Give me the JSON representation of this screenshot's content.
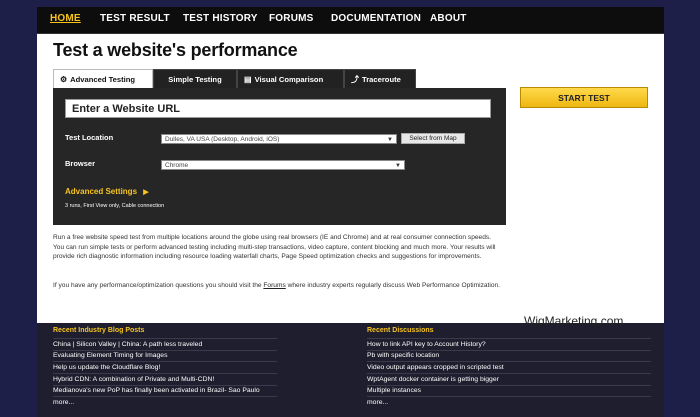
{
  "nav": {
    "items": [
      "HOME",
      "TEST RESULT",
      "TEST HISTORY",
      "FORUMS",
      "DOCUMENTATION",
      "ABOUT"
    ]
  },
  "page": {
    "title": "Test a website's performance"
  },
  "tabs": [
    "Advanced Testing",
    "Simple Testing",
    "Visual Comparison",
    "Traceroute"
  ],
  "form": {
    "url_placeholder": "Enter a Website URL",
    "location_label": "Test Location",
    "location_value": "Dulles, VA USA (Desktop, Android, iOS)",
    "select_from_map": "Select from Map",
    "browser_label": "Browser",
    "browser_value": "Chrome",
    "advanced_settings": "Advanced Settings",
    "advanced_summary": "3 runs, First View only, Cable connection",
    "start_test": "START TEST"
  },
  "description": {
    "paragraph1": "Run a free website speed test from multiple locations around the globe using real browsers (IE and Chrome) and at real consumer connection speeds. You can run simple tests or perform advanced testing including multi-step transactions, video capture, content blocking and much more. Your results will provide rich diagnostic information including resource loading waterfall charts, Page Speed optimization checks and suggestions for improvements.",
    "paragraph2_before": "If you have any performance/optimization questions you should visit the ",
    "paragraph2_link": "Forums",
    "paragraph2_after": " where industry experts regularly discuss Web Performance Optimization."
  },
  "blog": {
    "heading": "Recent Industry Blog Posts",
    "items": [
      "China | Silicon Valley | China: A path less traveled",
      "Evaluating Element Timing for Images",
      "Help us update the Cloudflare Blog!",
      "Hybrid CDN: A combination of Private and Multi-CDN!",
      "Medianova's new PoP has finally been activated in Brazil- Sao Paulo",
      "more..."
    ]
  },
  "discussions": {
    "heading": "Recent Discussions",
    "items": [
      "How to link API key to Account History?",
      "Pb with specific location",
      "Video output appears cropped in scripted test",
      "WptAgent docker container is getting bigger",
      "Multiple instances",
      "more..."
    ]
  },
  "watermark": "WigMarketing.com",
  "colors": {
    "accent": "#f7c41e",
    "frame": "#1d1f48",
    "panel": "#262626"
  },
  "icons": {
    "advanced_tab": "gear-icon",
    "visual_tab": "document-icon",
    "traceroute_tab": "route-icon",
    "advanced_arrow": "triangle-right-icon"
  }
}
